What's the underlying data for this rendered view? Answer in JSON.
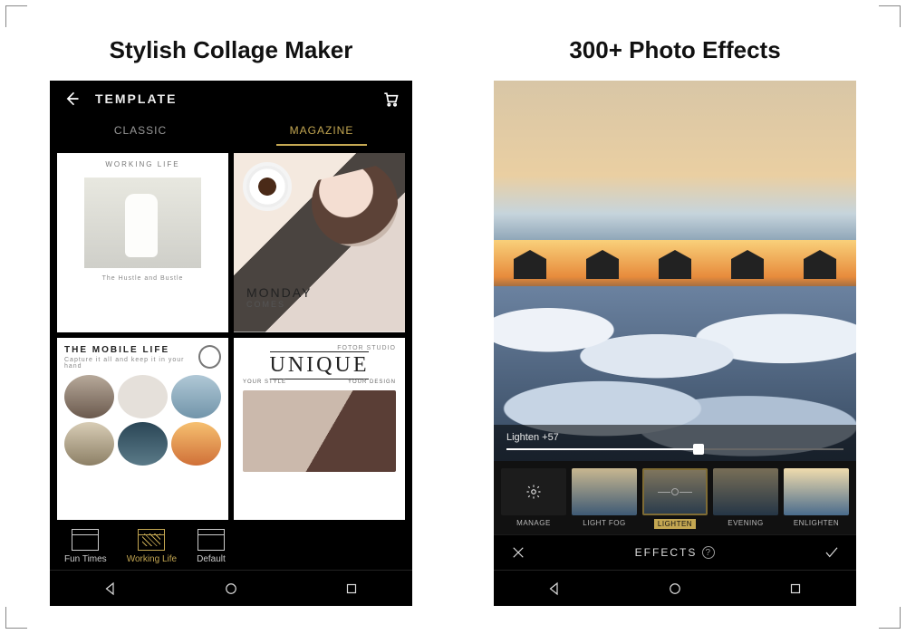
{
  "panels": {
    "left_title": "Stylish Collage Maker",
    "right_title": "300+ Photo Effects"
  },
  "collage": {
    "header_title": "TEMPLATE",
    "tabs": [
      "CLASSIC",
      "MAGAZINE"
    ],
    "active_tab": "MAGAZINE",
    "templates": {
      "t1": {
        "tag": "WORKING LIFE",
        "caption": "The Hustle and Bustle"
      },
      "t2": {
        "line1": "MONDAY",
        "line2": "COMES"
      },
      "t3": {
        "title": "THE MOBILE LIFE",
        "sub": "Capture it all and keep it in your hand"
      },
      "t4": {
        "brand": "FOTOR STUDIO",
        "title": "UNIQUE",
        "sub_left": "YOUR STYLE",
        "sub_right": "YOUR DESIGN"
      }
    },
    "themes": [
      {
        "label": "Fun Times"
      },
      {
        "label": "Working Life"
      },
      {
        "label": "Default"
      }
    ],
    "active_theme": "Working Life"
  },
  "effects": {
    "slider": {
      "label": "Lighten",
      "value": 57,
      "display": "Lighten  +57",
      "max": 100
    },
    "items": [
      {
        "label": "MANAGE",
        "kind": "manage"
      },
      {
        "label": "LIGHT FOG"
      },
      {
        "label": "LIGHTEN"
      },
      {
        "label": "EVENING"
      },
      {
        "label": "ENLIGHTEN"
      }
    ],
    "active_effect": "LIGHTEN",
    "bottom_label": "EFFECTS"
  }
}
